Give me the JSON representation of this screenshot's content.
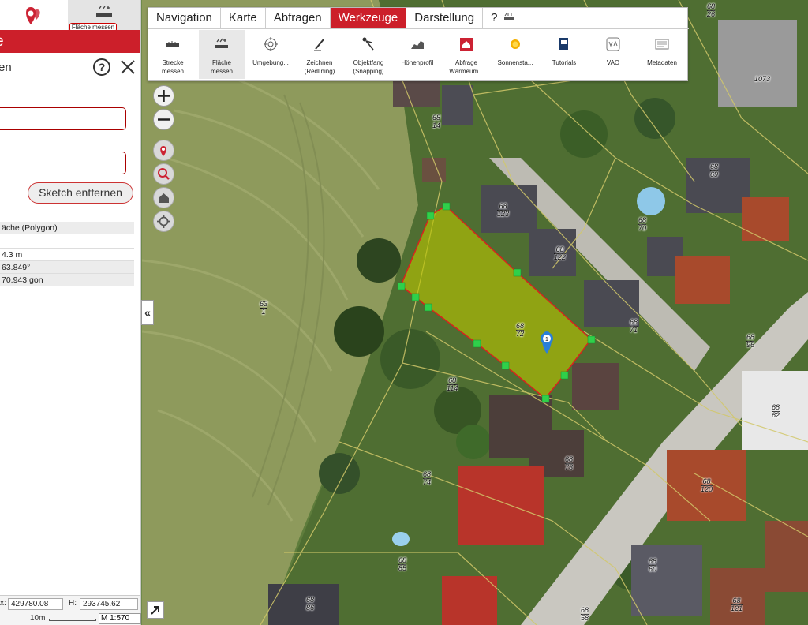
{
  "colors": {
    "accent": "#cc1f2a",
    "polygon_fill": "#b8c400",
    "vertex": "#2fd04a",
    "map_bg": "#6e8a4a"
  },
  "left_panel": {
    "tab_area_label": "Fläche messen",
    "header_title": "e",
    "subtitle": "en",
    "help_symbol": "?",
    "sketch_button": "Sketch entfernen",
    "info_rows": [
      "äche (Polygon)",
      "",
      "4.3 m",
      "63.849°",
      "70.943 gon"
    ],
    "coord_x_label": "x:",
    "coord_x_value": "429780.08",
    "coord_y_label": "H:",
    "coord_y_value": "293745.62",
    "scale_bar_label": "10m",
    "scale_label": "M 1:570"
  },
  "menu": {
    "tabs": [
      "Navigation",
      "Karte",
      "Abfragen",
      "Werkzeuge",
      "Darstellung",
      "?"
    ],
    "active_tab": "Werkzeuge"
  },
  "tools": [
    {
      "label": "Strecke\nmessen",
      "icon": "ruler-icon"
    },
    {
      "label": "Fläche\nmessen",
      "icon": "area-measure-icon",
      "active": true
    },
    {
      "label": "Umgebung...",
      "icon": "crosshair-icon"
    },
    {
      "label": "Zeichnen\n(Redlining)",
      "icon": "pen-icon"
    },
    {
      "label": "Objektfang\n(Snapping)",
      "icon": "snap-cursor-icon"
    },
    {
      "label": "Höhenprofil",
      "icon": "elevation-profile-icon"
    },
    {
      "label": "Abfrage\nWärmeum...",
      "icon": "house-heat-icon"
    },
    {
      "label": "Sonnensta...",
      "icon": "sun-icon"
    },
    {
      "label": "Tutorials",
      "icon": "tutorial-book-icon"
    },
    {
      "label": "VAO",
      "icon": "vao-icon"
    },
    {
      "label": "Metadaten",
      "icon": "metadata-icon"
    }
  ],
  "map": {
    "collapse_symbol": "«",
    "marker_number": "1",
    "parcels": [
      {
        "top": "68",
        "bottom": "26"
      },
      {
        "top": "1073",
        "bottom": ""
      },
      {
        "top": "68",
        "bottom": "14"
      },
      {
        "top": "68",
        "bottom": "69"
      },
      {
        "top": "68",
        "bottom": "123"
      },
      {
        "top": "68",
        "bottom": "122"
      },
      {
        "top": "68",
        "bottom": "70"
      },
      {
        "top": "63",
        "bottom": "1"
      },
      {
        "top": "68",
        "bottom": "71"
      },
      {
        "top": "68",
        "bottom": "72"
      },
      {
        "top": "68",
        "bottom": "96"
      },
      {
        "top": "68",
        "bottom": "114"
      },
      {
        "top": "68",
        "bottom": "62"
      },
      {
        "top": "68",
        "bottom": "74"
      },
      {
        "top": "68",
        "bottom": "73"
      },
      {
        "top": "68",
        "bottom": "120"
      },
      {
        "top": "68",
        "bottom": "85"
      },
      {
        "top": "68",
        "bottom": "60"
      },
      {
        "top": "68",
        "bottom": "86"
      },
      {
        "top": "68",
        "bottom": "58"
      },
      {
        "top": "68",
        "bottom": "121"
      }
    ]
  }
}
